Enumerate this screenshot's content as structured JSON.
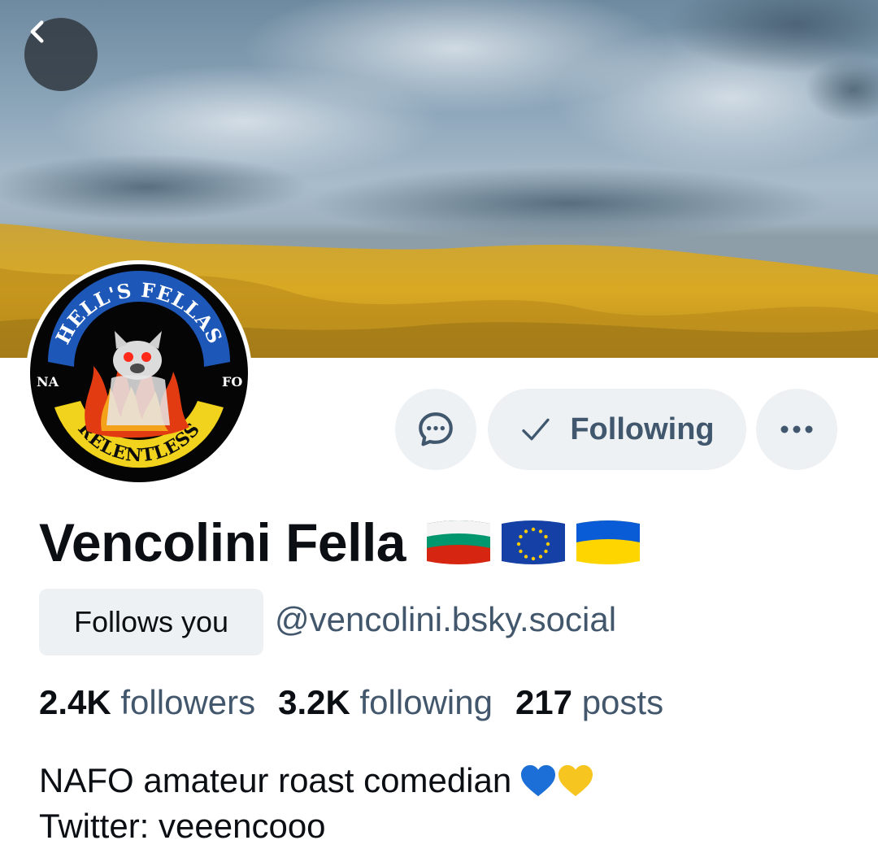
{
  "profile": {
    "display_name": "Vencolini Fella",
    "handle": "@vencolini.bsky.social",
    "follows_you_label": "Follows you",
    "flags": [
      "bulgaria-flag-icon",
      "eu-flag-icon",
      "ukraine-flag-icon"
    ]
  },
  "avatar": {
    "top_text": "HELL'S FELLAS",
    "left_text": "NA",
    "right_text": "FO",
    "bottom_text": "RELENTLESS"
  },
  "actions": {
    "message_icon": "chat-bubble-icon",
    "following_label": "Following",
    "following_icon": "checkmark-icon",
    "more_icon": "ellipsis-icon"
  },
  "stats": {
    "followers_count": "2.4K",
    "followers_label": "followers",
    "following_count": "3.2K",
    "following_label": "following",
    "posts_count": "217",
    "posts_label": "posts"
  },
  "bio": {
    "line1": "NAFO amateur roast comedian",
    "line2": "Twitter: veeencooo",
    "hearts": [
      "blue-heart-icon",
      "yellow-heart-icon"
    ]
  },
  "colors": {
    "muted_text": "#42576c",
    "button_bg": "#eef1f4",
    "button_text": "#40576d"
  }
}
